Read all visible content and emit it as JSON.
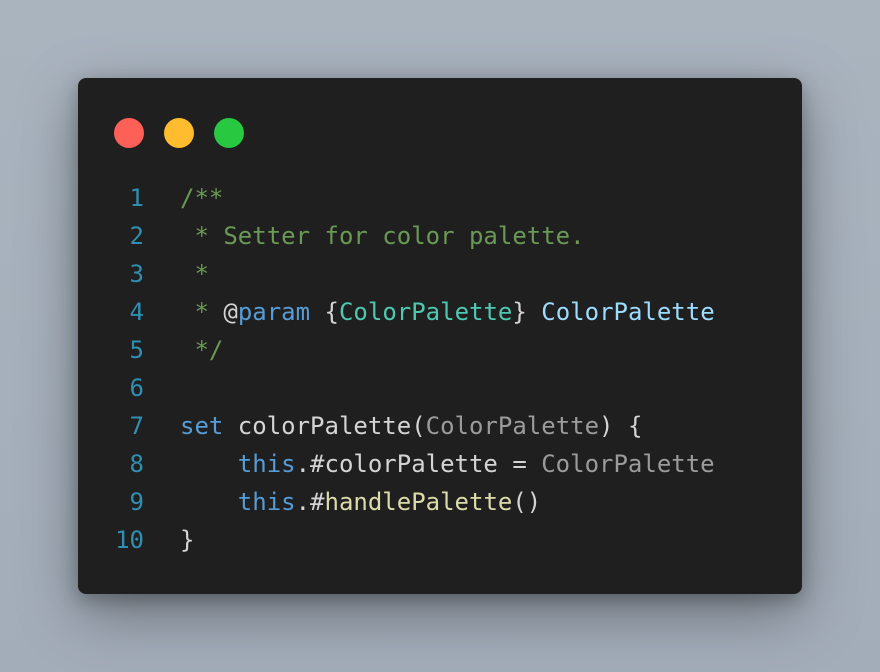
{
  "colors": {
    "red": "#fe5f57",
    "yellow": "#febc2e",
    "green": "#28c840",
    "comment": "#6a9955",
    "keyword": "#569cd6",
    "type": "#4ec9b0",
    "variable": "#9cdcfe",
    "default": "#d4d4d4",
    "parameter": "#9b9b9b",
    "function": "#dcdcaa",
    "line_number": "#2f8fb3"
  },
  "window_controls": [
    {
      "name": "close-dot",
      "color": "#fe5f57"
    },
    {
      "name": "minimize-dot",
      "color": "#febc2e"
    },
    {
      "name": "maximize-dot",
      "color": "#28c840"
    }
  ],
  "code_lines": [
    {
      "number": "1",
      "tokens": [
        {
          "text": "/**",
          "role": "comment"
        }
      ]
    },
    {
      "number": "2",
      "tokens": [
        {
          "text": " * Setter for color palette.",
          "role": "comment"
        }
      ]
    },
    {
      "number": "3",
      "tokens": [
        {
          "text": " *",
          "role": "comment"
        }
      ]
    },
    {
      "number": "4",
      "tokens": [
        {
          "text": " * ",
          "role": "comment"
        },
        {
          "text": "@",
          "role": "default"
        },
        {
          "text": "param",
          "role": "keyword"
        },
        {
          "text": " {",
          "role": "default"
        },
        {
          "text": "ColorPalette",
          "role": "type"
        },
        {
          "text": "} ",
          "role": "default"
        },
        {
          "text": "ColorPalette",
          "role": "variable"
        }
      ]
    },
    {
      "number": "5",
      "tokens": [
        {
          "text": " */",
          "role": "comment"
        }
      ]
    },
    {
      "number": "6",
      "tokens": []
    },
    {
      "number": "7",
      "tokens": [
        {
          "text": "set",
          "role": "keyword"
        },
        {
          "text": " colorPalette(",
          "role": "default"
        },
        {
          "text": "ColorPalette",
          "role": "parameter"
        },
        {
          "text": ") {",
          "role": "default"
        }
      ]
    },
    {
      "number": "8",
      "tokens": [
        {
          "text": "    ",
          "role": "default"
        },
        {
          "text": "this",
          "role": "keyword"
        },
        {
          "text": ".#colorPalette = ",
          "role": "default"
        },
        {
          "text": "ColorPalette",
          "role": "parameter"
        }
      ]
    },
    {
      "number": "9",
      "tokens": [
        {
          "text": "    ",
          "role": "default"
        },
        {
          "text": "this",
          "role": "keyword"
        },
        {
          "text": ".#",
          "role": "default"
        },
        {
          "text": "handlePalette",
          "role": "function"
        },
        {
          "text": "()",
          "role": "default"
        }
      ]
    },
    {
      "number": "10",
      "tokens": [
        {
          "text": "}",
          "role": "default"
        }
      ]
    }
  ]
}
